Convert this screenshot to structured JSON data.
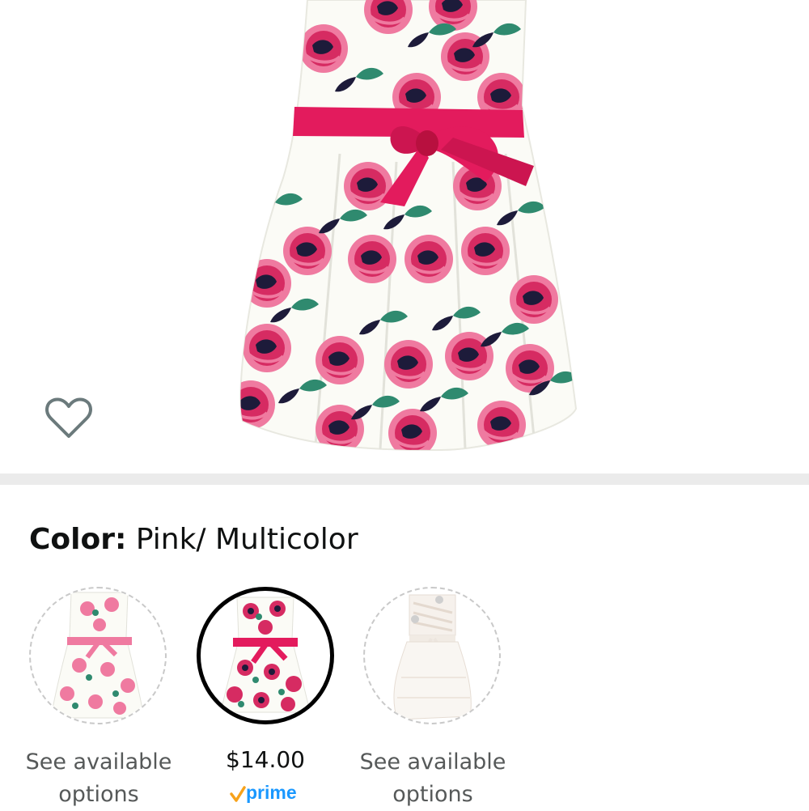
{
  "product": {
    "image_alt": "Pink floral dress with pink satin sash",
    "wishlist_icon": "heart-outline-icon"
  },
  "color": {
    "label": "Color:",
    "value": "Pink/ Multicolor"
  },
  "swatches": [
    {
      "caption_line1": "See available",
      "caption_line2": "options",
      "selected": false
    },
    {
      "price": "$14.00",
      "badge": "prime",
      "selected": true
    },
    {
      "caption_line1": "See available",
      "caption_line2": "options",
      "selected": false
    }
  ],
  "colors": {
    "sash": "#e31b5d",
    "rose": "#d62b62",
    "rose_light": "#ef7aa0",
    "leaf": "#2f8a6f",
    "navy": "#1d1b3a",
    "prime_blue": "#1a98ff",
    "prime_check": "#f7a21a",
    "separator": "#ebebeb"
  }
}
